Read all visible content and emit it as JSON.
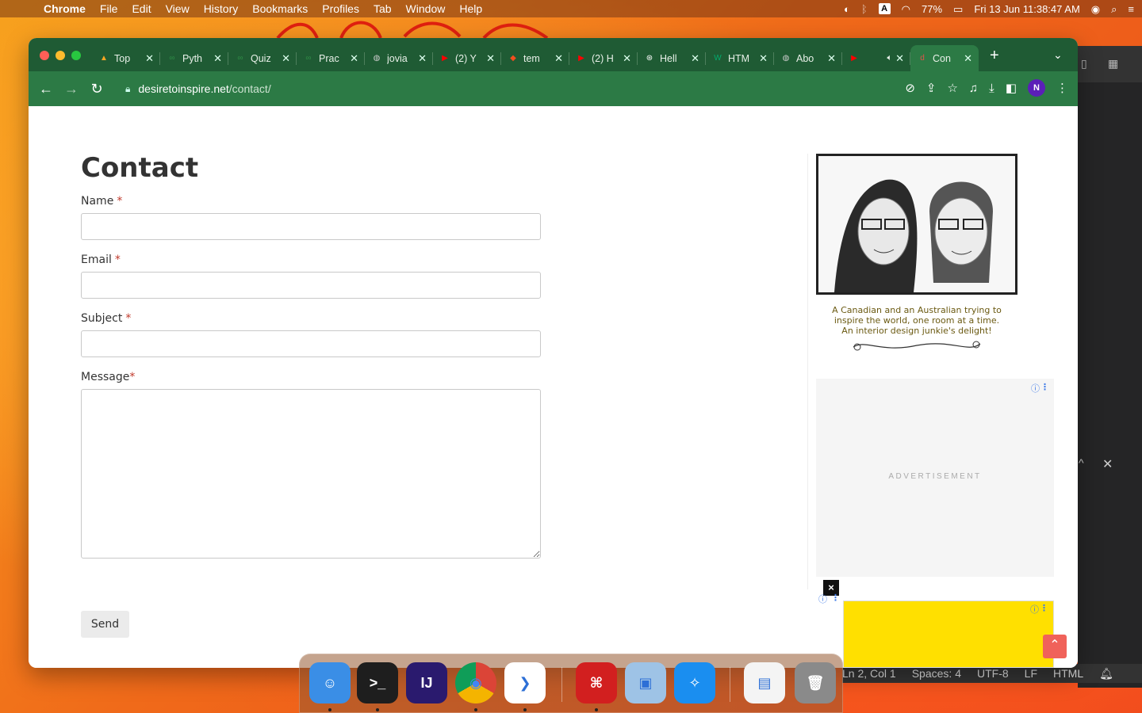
{
  "menubar": {
    "app": "Chrome",
    "items": [
      "File",
      "Edit",
      "View",
      "History",
      "Bookmarks",
      "Profiles",
      "Tab",
      "Window",
      "Help"
    ],
    "battery": "77%",
    "clock": "Fri 13 Jun  11:38:47 AM",
    "input_source": "A"
  },
  "browser": {
    "tabs": [
      {
        "title": "Top",
        "icon": "flame-icon",
        "color": "#f5a623"
      },
      {
        "title": "Pyth",
        "icon": "gfg-icon",
        "color": "#2f8d46"
      },
      {
        "title": "Quiz",
        "icon": "gfg-icon",
        "color": "#2f8d46"
      },
      {
        "title": "Prac",
        "icon": "gfg-icon",
        "color": "#2f8d46"
      },
      {
        "title": "jovia",
        "icon": "globe-icon",
        "color": "#cccccc"
      },
      {
        "title": "(2) Y",
        "icon": "youtube-icon",
        "color": "#ff0000"
      },
      {
        "title": "tem",
        "icon": "figma-icon",
        "color": "#f24e1e"
      },
      {
        "title": "(2) H",
        "icon": "youtube-icon",
        "color": "#ff0000"
      },
      {
        "title": "Hell",
        "icon": "openai-icon",
        "color": "#ffffff"
      },
      {
        "title": "HTM",
        "icon": "w3-icon",
        "color": "#04aa6d"
      },
      {
        "title": "Abo",
        "icon": "globe-icon",
        "color": "#cccccc"
      },
      {
        "title": "",
        "icon": "youtube-icon",
        "color": "#ff0000"
      },
      {
        "title": "Con",
        "icon": "dti-icon",
        "color": "#e0524a",
        "active": true
      }
    ],
    "url_domain": "desiretoinspire.net",
    "url_path": "/contact/",
    "profile_initial": "N"
  },
  "page": {
    "title": "Contact",
    "fields": {
      "name_label": "Name",
      "email_label": "Email",
      "subject_label": "Subject",
      "message_label": "Message",
      "required_mark": "*"
    },
    "send_label": "Send",
    "tagline": [
      "A Canadian and an Australian trying to",
      "inspire the world, one room at a time.",
      "An interior design junkie's delight!"
    ],
    "ad_label": "ADVERTISEMENT",
    "ad_close": "×"
  },
  "editor_status": {
    "position": "Ln 2, Col 1",
    "spaces": "Spaces: 4",
    "encoding": "UTF-8",
    "eol": "LF",
    "language": "HTML"
  },
  "dock": {
    "apps": [
      {
        "name": "finder-icon",
        "color": "#3a8ee6"
      },
      {
        "name": "terminal-icon",
        "color": "#1e1e1e"
      },
      {
        "name": "intellij-icon",
        "color": "#2a1a6e"
      },
      {
        "name": "chrome-icon",
        "color": "#ffffff"
      },
      {
        "name": "vscode-icon",
        "color": "#ffffff"
      },
      {
        "name": "acrobat-icon",
        "color": "#d21f1f"
      },
      {
        "name": "preview-icon",
        "color": "#9ec3e6"
      },
      {
        "name": "safari-icon",
        "color": "#1a8ef0"
      },
      {
        "name": "chrome-window-icon",
        "color": "#f4f4f4"
      },
      {
        "name": "trash-icon",
        "color": "#8a8a8a"
      }
    ],
    "terminal_glyph": ">_",
    "intellij_glyph": "IJ"
  }
}
